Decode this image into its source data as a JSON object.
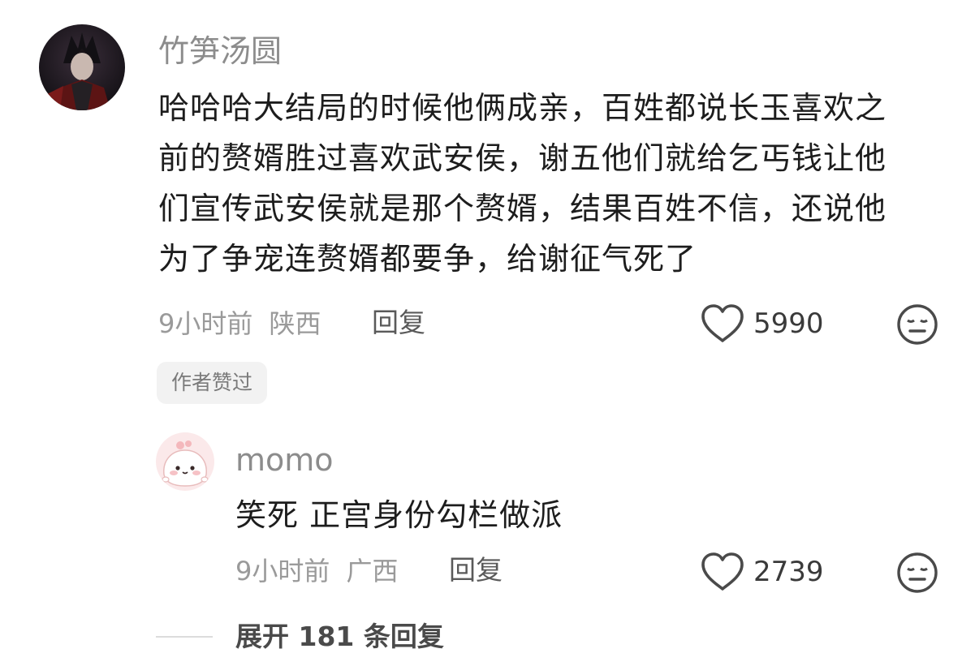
{
  "comment": {
    "username": "竹笋汤圆",
    "text_lines": [
      "哈哈哈大结局的时候他俩成亲，百姓都说长玉喜欢之",
      "前的赘婿胜过喜欢武安侯，谢五他们就给乞丐钱让他",
      "们宣传武安侯就是那个赘婿，结果百姓不信，还说他",
      "为了争宠连赘婿都要争，给谢征气死了"
    ],
    "time": "9小时前",
    "location": "陕西",
    "reply_label": "回复",
    "like_count": "5990",
    "badge": "作者赞过",
    "avatar_icon": "avatar-dark-character",
    "like_icon": "heart-outline-icon",
    "reaction_icon": "meh-face-icon"
  },
  "reply": {
    "username": "momo",
    "text": "笑死 正宫身份勾栏做派",
    "time": "9小时前",
    "location": "广西",
    "reply_label": "回复",
    "like_count": "2739",
    "avatar_icon": "pink-dumpling-avatar",
    "like_icon": "heart-outline-icon",
    "reaction_icon": "meh-face-icon"
  },
  "expand_label": "展开 181 条回复",
  "colors": {
    "text": "#1d1d1d",
    "meta": "#9a9a9a",
    "badge_bg": "#f2f2f2",
    "avatar_pink": "#f8dede"
  }
}
